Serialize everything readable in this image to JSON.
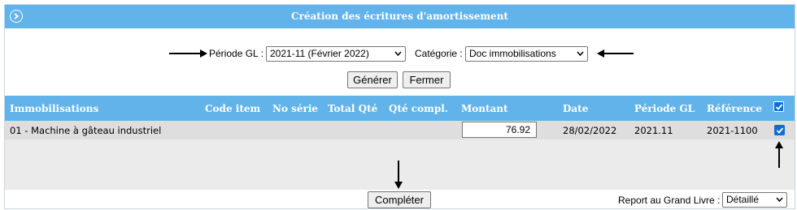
{
  "window": {
    "title": "Création des écritures d'amortissement",
    "collapse_icon": "circle-chevron-right-icon"
  },
  "filters": {
    "period_label": "Période GL :",
    "period_value": "2021-11 (Février 2022)",
    "category_label": "Catégorie :",
    "category_value": "Doc immobilisations"
  },
  "actions": {
    "generate_label": "Générer",
    "close_label": "Fermer"
  },
  "table": {
    "columns": [
      "Immobilisations",
      "Code item",
      "No série",
      "Total Qté",
      "Qté compl.",
      "Montant",
      "Date",
      "Période GL",
      "Référence"
    ],
    "select_all_checked": true,
    "rows": [
      {
        "asset": "01 - Machine à gâteau industriel",
        "item_code": "",
        "serial_no": "",
        "total_qty": "",
        "qty_compl": "",
        "amount": "76.92",
        "date": "28/02/2022",
        "gl_period": "2021.11",
        "reference": "2021-1100",
        "checked": true
      }
    ]
  },
  "footer": {
    "complete_label": "Compléter",
    "report_label": "Report au Grand Livre :",
    "report_value": "Détaillé"
  },
  "colors": {
    "header_blue": "#62b3ea",
    "checkbox_blue": "#0b6dd9",
    "row_grey": "#dedede"
  }
}
